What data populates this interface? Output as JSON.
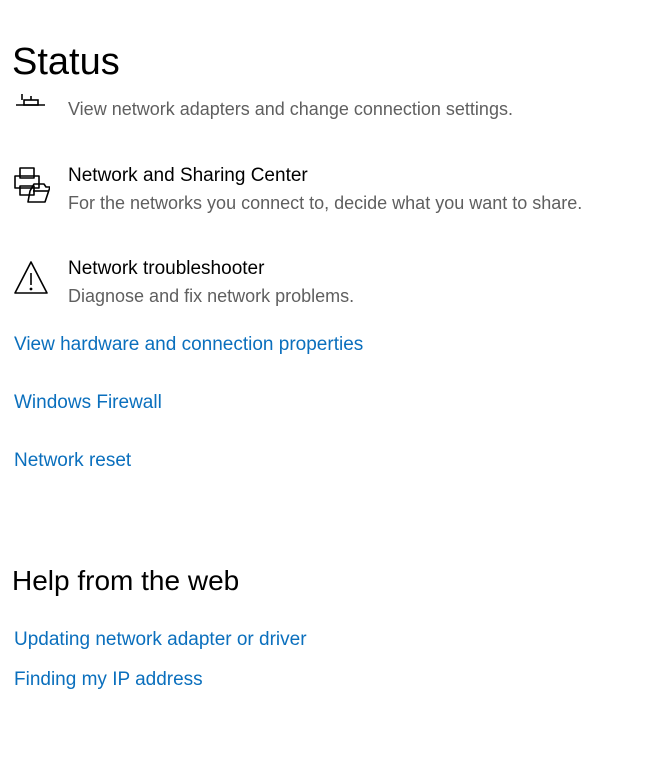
{
  "page": {
    "title": "Status"
  },
  "settings": [
    {
      "title": "",
      "description": "View network adapters and change connection settings.",
      "icon": "network-adapter-icon"
    },
    {
      "title": "Network and Sharing Center",
      "description": "For the networks you connect to, decide what you want to share.",
      "icon": "printer-folder-icon"
    },
    {
      "title": "Network troubleshooter",
      "description": "Diagnose and fix network problems.",
      "icon": "warning-icon"
    }
  ],
  "links": {
    "hardware_properties": "View hardware and connection properties",
    "windows_firewall": "Windows Firewall",
    "network_reset": "Network reset"
  },
  "help": {
    "title": "Help from the web",
    "links": [
      "Updating network adapter or driver",
      "Finding my IP address"
    ]
  },
  "colors": {
    "link": "#0a6fbd",
    "description": "#5f5f5f",
    "text": "#000000",
    "background": "#ffffff"
  }
}
